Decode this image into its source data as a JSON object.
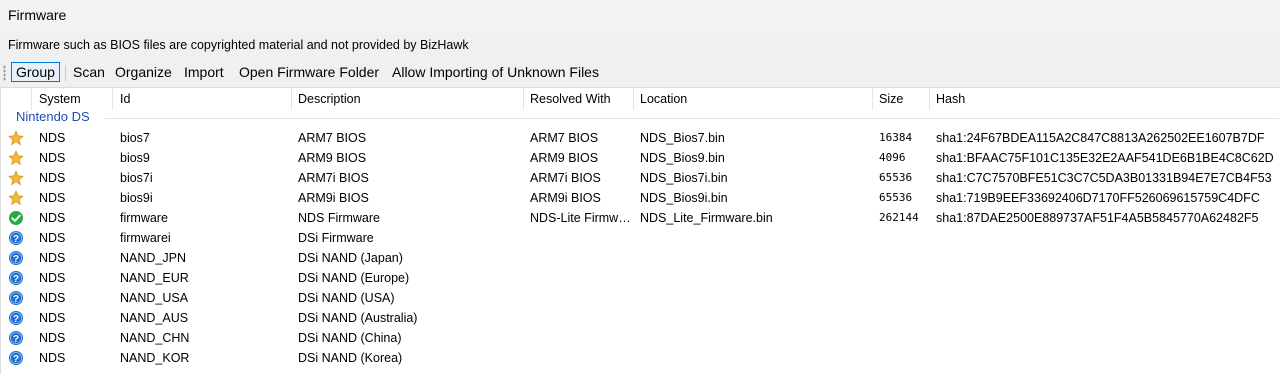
{
  "window": {
    "title": "Firmware"
  },
  "notice": "Firmware such as BIOS files are copyrighted material and not provided by BizHawk",
  "toolbar": {
    "group": "Group",
    "scan": "Scan",
    "organize": "Organize",
    "import": "Import",
    "open_folder": "Open Firmware Folder",
    "allow_unknown": "Allow Importing of Unknown Files"
  },
  "columns": {
    "system": "System",
    "id": "Id",
    "description": "Description",
    "resolved_with": "Resolved With",
    "location": "Location",
    "size": "Size",
    "hash": "Hash"
  },
  "group_name": "Nintendo DS",
  "rows": [
    {
      "status": "star-icon",
      "system": "NDS",
      "id": "bios7",
      "description": "ARM7 BIOS",
      "resolved_with": "ARM7 BIOS",
      "location": "NDS_Bios7.bin",
      "size": "16384",
      "hash": "sha1:24F67BDEA115A2C847C8813A262502EE1607B7DF"
    },
    {
      "status": "star-icon",
      "system": "NDS",
      "id": "bios9",
      "description": "ARM9 BIOS",
      "resolved_with": "ARM9 BIOS",
      "location": "NDS_Bios9.bin",
      "size": "4096",
      "hash": "sha1:BFAAC75F101C135E32E2AAF541DE6B1BE4C8C62D"
    },
    {
      "status": "star-icon",
      "system": "NDS",
      "id": "bios7i",
      "description": "ARM7i BIOS",
      "resolved_with": "ARM7i BIOS",
      "location": "NDS_Bios7i.bin",
      "size": "65536",
      "hash": "sha1:C7C7570BFE51C3C7C5DA3B01331B94E7E7CB4F53"
    },
    {
      "status": "star-icon",
      "system": "NDS",
      "id": "bios9i",
      "description": "ARM9i BIOS",
      "resolved_with": "ARM9i BIOS",
      "location": "NDS_Bios9i.bin",
      "size": "65536",
      "hash": "sha1:719B9EEF33692406D7170FF526069615759C4DFC"
    },
    {
      "status": "check-icon",
      "system": "NDS",
      "id": "firmware",
      "description": "NDS Firmware",
      "resolved_with": "NDS-Lite Firmw…",
      "location": "NDS_Lite_Firmware.bin",
      "size": "262144",
      "hash": "sha1:87DAE2500E889737AF51F4A5B5845770A62482F5"
    },
    {
      "status": "question-icon",
      "system": "NDS",
      "id": "firmwarei",
      "description": "DSi Firmware",
      "resolved_with": "",
      "location": "",
      "size": "",
      "hash": ""
    },
    {
      "status": "question-icon",
      "system": "NDS",
      "id": "NAND_JPN",
      "description": "DSi NAND (Japan)",
      "resolved_with": "",
      "location": "",
      "size": "",
      "hash": ""
    },
    {
      "status": "question-icon",
      "system": "NDS",
      "id": "NAND_EUR",
      "description": "DSi NAND (Europe)",
      "resolved_with": "",
      "location": "",
      "size": "",
      "hash": ""
    },
    {
      "status": "question-icon",
      "system": "NDS",
      "id": "NAND_USA",
      "description": "DSi NAND (USA)",
      "resolved_with": "",
      "location": "",
      "size": "",
      "hash": ""
    },
    {
      "status": "question-icon",
      "system": "NDS",
      "id": "NAND_AUS",
      "description": "DSi NAND (Australia)",
      "resolved_with": "",
      "location": "",
      "size": "",
      "hash": ""
    },
    {
      "status": "question-icon",
      "system": "NDS",
      "id": "NAND_CHN",
      "description": "DSi NAND (China)",
      "resolved_with": "",
      "location": "",
      "size": "",
      "hash": ""
    },
    {
      "status": "question-icon",
      "system": "NDS",
      "id": "NAND_KOR",
      "description": "DSi NAND (Korea)",
      "resolved_with": "",
      "location": "",
      "size": "",
      "hash": ""
    }
  ],
  "colors": {
    "group_text": "#1e4fb4",
    "check": "#2aa845",
    "question": "#1f6fd1",
    "star": "#f2b83a"
  }
}
